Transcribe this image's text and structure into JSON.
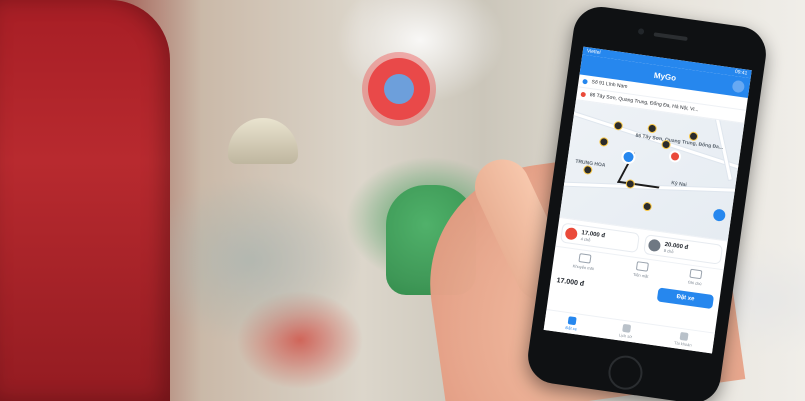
{
  "app": {
    "status_time": "09:41",
    "carrier": "Viettel",
    "title": "MyGo"
  },
  "trip": {
    "pickup": "Số 91 Lĩnh Nam",
    "dropoff": "86 Tây Sơn, Quang Trung, Đống Đa, Hà Nội, Vi..."
  },
  "map": {
    "area_label": "TRUNG HOA",
    "street_label": "86 Tây Sơn, Quang Trung, Đống Đa...",
    "side_label": "Kỳ Nai"
  },
  "fares": [
    {
      "price": "17.000 đ",
      "sub": "4 chỗ",
      "icon": "motorbike-icon"
    },
    {
      "price": "20.000 đ",
      "sub": "8 chỗ",
      "icon": "car-icon"
    }
  ],
  "options": [
    {
      "label": "Khuyến mãi",
      "icon": "promo-icon"
    },
    {
      "label": "Tiền mặt",
      "icon": "cash-icon"
    },
    {
      "label": "Ghi chú",
      "icon": "note-icon"
    }
  ],
  "summary": {
    "total": "17.000 đ",
    "book_label": "Đặt xe"
  },
  "nav": [
    {
      "label": "Đặt xe",
      "active": true
    },
    {
      "label": "Lịch sử",
      "active": false
    },
    {
      "label": "Tài khoản",
      "active": false
    }
  ],
  "colors": {
    "accent": "#2a86e8",
    "pickup_pin": "#2a86e8",
    "dropoff_pin": "#e44c3c"
  }
}
